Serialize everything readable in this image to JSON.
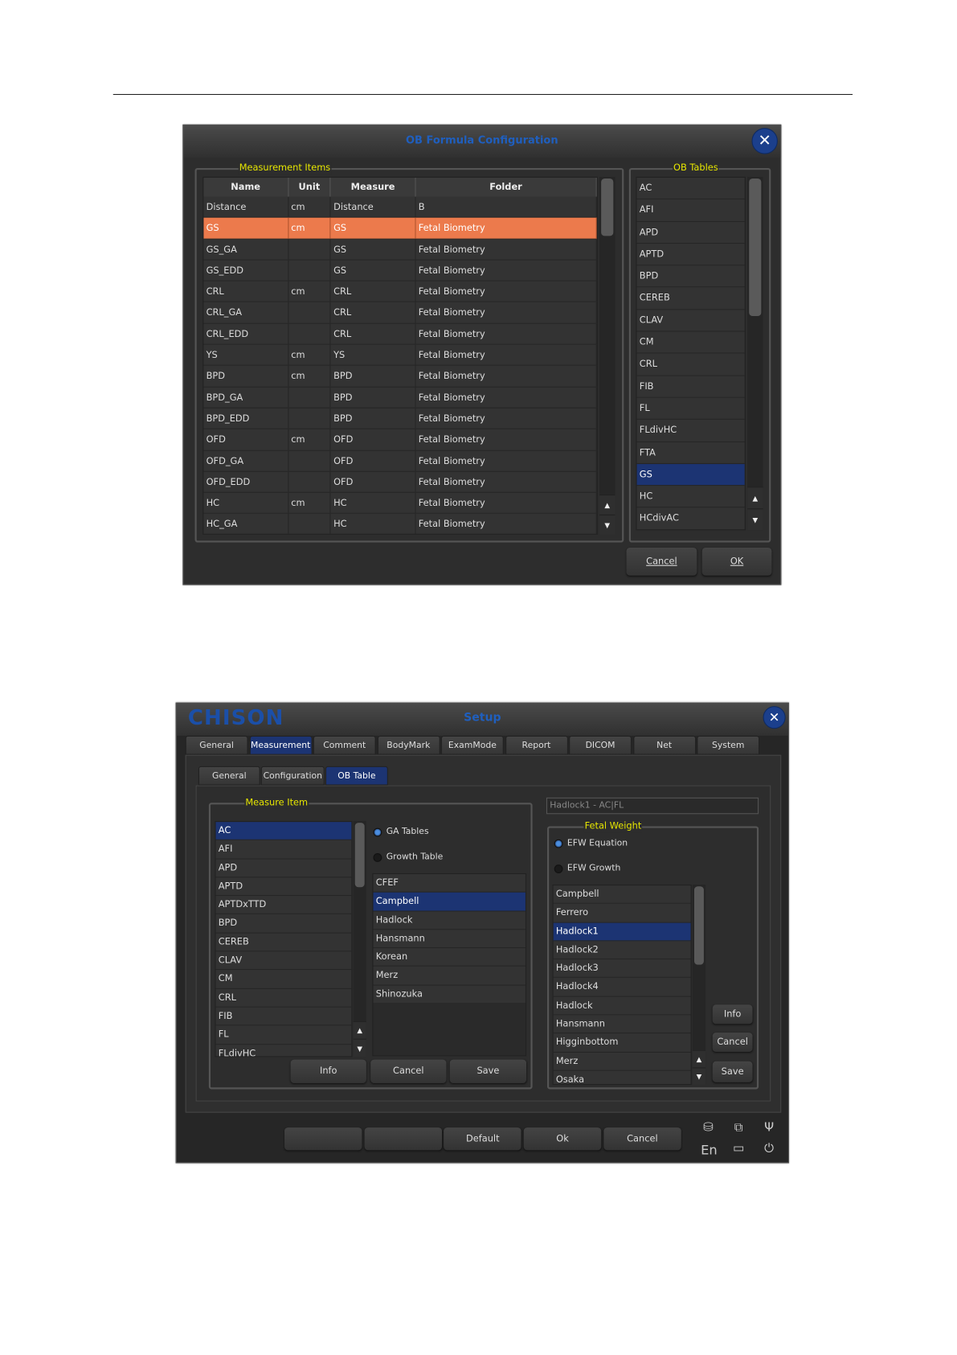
{
  "dialog1": {
    "title": "OB Formula Configuration",
    "close_label": "✕",
    "measurement_items": {
      "legend": "Measurement Items",
      "columns": [
        "Name",
        "Unit",
        "Measure",
        "Folder"
      ],
      "rows": [
        [
          "Distance",
          "cm",
          "Distance",
          "B"
        ],
        [
          "GS",
          "cm",
          "GS",
          "Fetal Biometry"
        ],
        [
          "GS_GA",
          "",
          "GS",
          "Fetal Biometry"
        ],
        [
          "GS_EDD",
          "",
          "GS",
          "Fetal Biometry"
        ],
        [
          "CRL",
          "cm",
          "CRL",
          "Fetal Biometry"
        ],
        [
          "CRL_GA",
          "",
          "CRL",
          "Fetal Biometry"
        ],
        [
          "CRL_EDD",
          "",
          "CRL",
          "Fetal Biometry"
        ],
        [
          "YS",
          "cm",
          "YS",
          "Fetal Biometry"
        ],
        [
          "BPD",
          "cm",
          "BPD",
          "Fetal Biometry"
        ],
        [
          "BPD_GA",
          "",
          "BPD",
          "Fetal Biometry"
        ],
        [
          "BPD_EDD",
          "",
          "BPD",
          "Fetal Biometry"
        ],
        [
          "OFD",
          "cm",
          "OFD",
          "Fetal Biometry"
        ],
        [
          "OFD_GA",
          "",
          "OFD",
          "Fetal Biometry"
        ],
        [
          "OFD_EDD",
          "",
          "OFD",
          "Fetal Biometry"
        ],
        [
          "HC",
          "cm",
          "HC",
          "Fetal Biometry"
        ],
        [
          "HC_GA",
          "",
          "HC",
          "Fetal Biometry"
        ]
      ],
      "selected_row": 1
    },
    "ob_tables": {
      "legend": "OB Tables",
      "items": [
        "AC",
        "AFI",
        "APD",
        "APTD",
        "BPD",
        "CEREB",
        "CLAV",
        "CM",
        "CRL",
        "FIB",
        "FL",
        "FLdivHC",
        "FTA",
        "GS",
        "HC",
        "HCdivAC"
      ],
      "selected": 13
    },
    "buttons": {
      "cancel": "Cancel",
      "ok": "OK"
    },
    "scroll_up": "▲",
    "scroll_down": "▼"
  },
  "dialog2": {
    "logo": "CHISON",
    "title": "Setup",
    "close_label": "✕",
    "tabs": [
      "General",
      "Measurement",
      "Comment",
      "BodyMark",
      "ExamMode",
      "Report",
      "DICOM",
      "Net",
      "System"
    ],
    "selected_tab": 1,
    "subtabs": [
      "General",
      "Configuration",
      "OB Table"
    ],
    "selected_subtab": 2,
    "measure_item": {
      "legend": "Measure Item",
      "items": [
        "AC",
        "AFI",
        "APD",
        "APTD",
        "APTDxTTD",
        "BPD",
        "CEREB",
        "CLAV",
        "CM",
        "CRL",
        "FIB",
        "FL",
        "FLdivHC"
      ],
      "selected": 0,
      "radio_ga": "GA Tables",
      "radio_growth": "Growth Table",
      "ga_selected": "GA Tables",
      "tables": [
        "CFEF",
        "Campbell",
        "Hadlock",
        "Hansmann",
        "Korean",
        "Merz",
        "Shinozuka"
      ],
      "tables_selected": 1,
      "buttons": {
        "info": "Info",
        "cancel": "Cancel",
        "save": "Save"
      }
    },
    "formula_field": "Hadlock1 - AC|FL",
    "fetal_weight": {
      "legend": "Fetal Weight",
      "radio_equation": "EFW Equation",
      "radio_growth": "EFW Growth",
      "items": [
        "Campbell",
        "Ferrero",
        "Hadlock1",
        "Hadlock2",
        "Hadlock3",
        "Hadlock4",
        "Hadlock",
        "Hansmann",
        "Higginbottom",
        "Merz",
        "Osaka"
      ],
      "selected": 2,
      "buttons": {
        "info": "Info",
        "cancel": "Cancel",
        "save": "Save"
      }
    },
    "bottom_buttons": [
      "",
      "",
      "Default",
      "Ok",
      "Cancel"
    ],
    "status": {
      "language": "En"
    },
    "scroll_up": "▲",
    "scroll_down": "▼",
    "colors": {
      "selection": "#1c3473",
      "highlight": "#ec7a4c",
      "legend": "#e6e600",
      "title": "#1f5fbf"
    }
  }
}
